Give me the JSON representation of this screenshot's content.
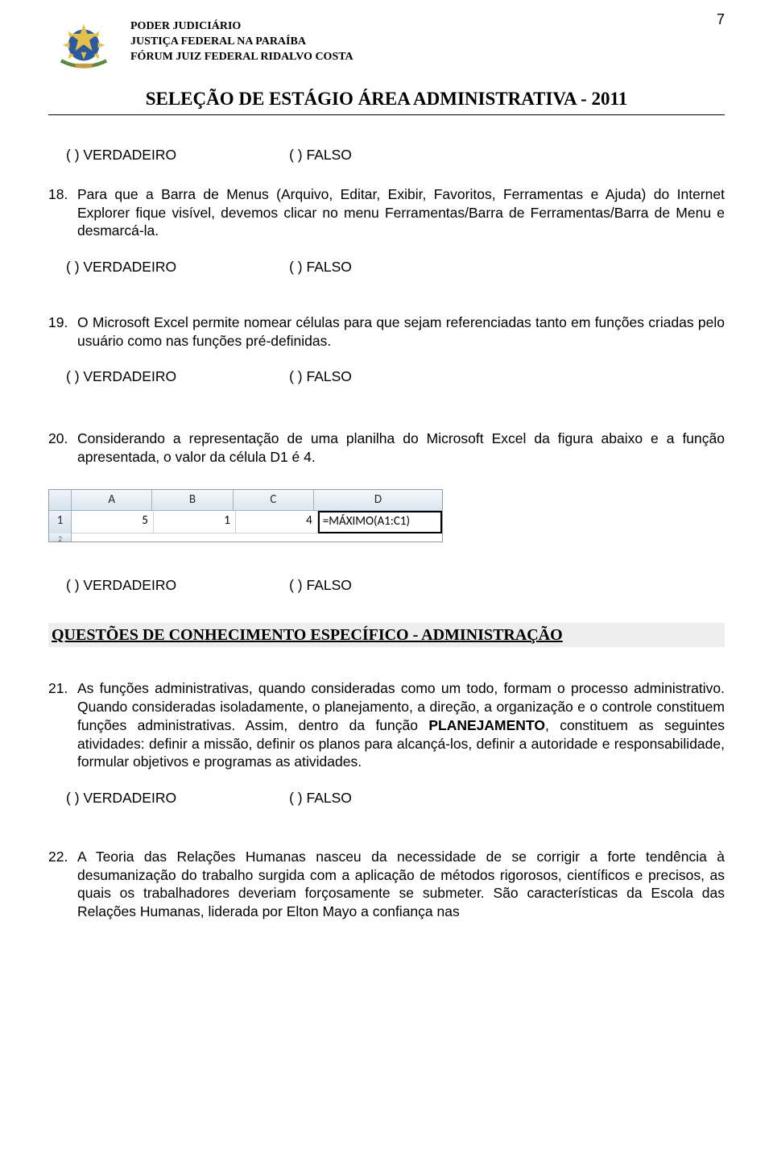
{
  "page_number": "7",
  "header": {
    "line1": "PODER JUDICIÁRIO",
    "line2": "JUSTIÇA FEDERAL NA PARAÍBA",
    "line3": "FÓRUM JUIZ FEDERAL RIDALVO COSTA"
  },
  "title": "SELEÇÃO DE ESTÁGIO ÁREA ADMINISTRATIVA - 2011",
  "tf": {
    "true": "(   ) VERDADEIRO",
    "false": "(   ) FALSO"
  },
  "q18": {
    "num": "18.",
    "text": "Para que a Barra de Menus (Arquivo, Editar, Exibir, Favoritos, Ferramentas e Ajuda) do Internet Explorer fique visível, devemos clicar no menu Ferramentas/Barra de Ferramentas/Barra de Menu e desmarcá-la."
  },
  "q19": {
    "num": "19.",
    "text": "O Microsoft Excel permite nomear células para que sejam referenciadas tanto em funções criadas pelo usuário como nas funções pré-definidas."
  },
  "q20": {
    "num": "20.",
    "text": "Considerando a representação de uma planilha do Microsoft Excel da figura abaixo e a função apresentada, o valor da célula D1 é 4."
  },
  "excel": {
    "cols": {
      "a": "A",
      "b": "B",
      "c": "C",
      "d": "D"
    },
    "row1": "1",
    "row2": "2",
    "a1": "5",
    "b1": "1",
    "c1": "4",
    "d1": "=MÁXIMO(A1:C1)"
  },
  "section_heading": "QUESTÕES DE CONHECIMENTO ESPECÍFICO - ADMINISTRAÇÃO",
  "q21": {
    "num": "21.",
    "text_pre": "As funções administrativas, quando consideradas como um todo, formam o processo administrativo. Quando consideradas isoladamente, o planejamento, a direção, a organização e o controle constituem funções administrativas. Assim, dentro da função ",
    "bold": "PLANEJAMENTO",
    "text_post": ", constituem as seguintes atividades: definir a missão, definir os planos para alcançá-los, definir a autoridade e responsabilidade, formular objetivos e programas as atividades."
  },
  "q22": {
    "num": "22.",
    "text": "A Teoria das Relações Humanas nasceu da necessidade de se corrigir a forte tendência à desumanização do trabalho surgida com a aplicação de métodos rigorosos, científicos e precisos, as quais os trabalhadores deveriam forçosamente se submeter. São características da Escola das Relações Humanas, liderada por Elton Mayo  a confiança nas"
  }
}
